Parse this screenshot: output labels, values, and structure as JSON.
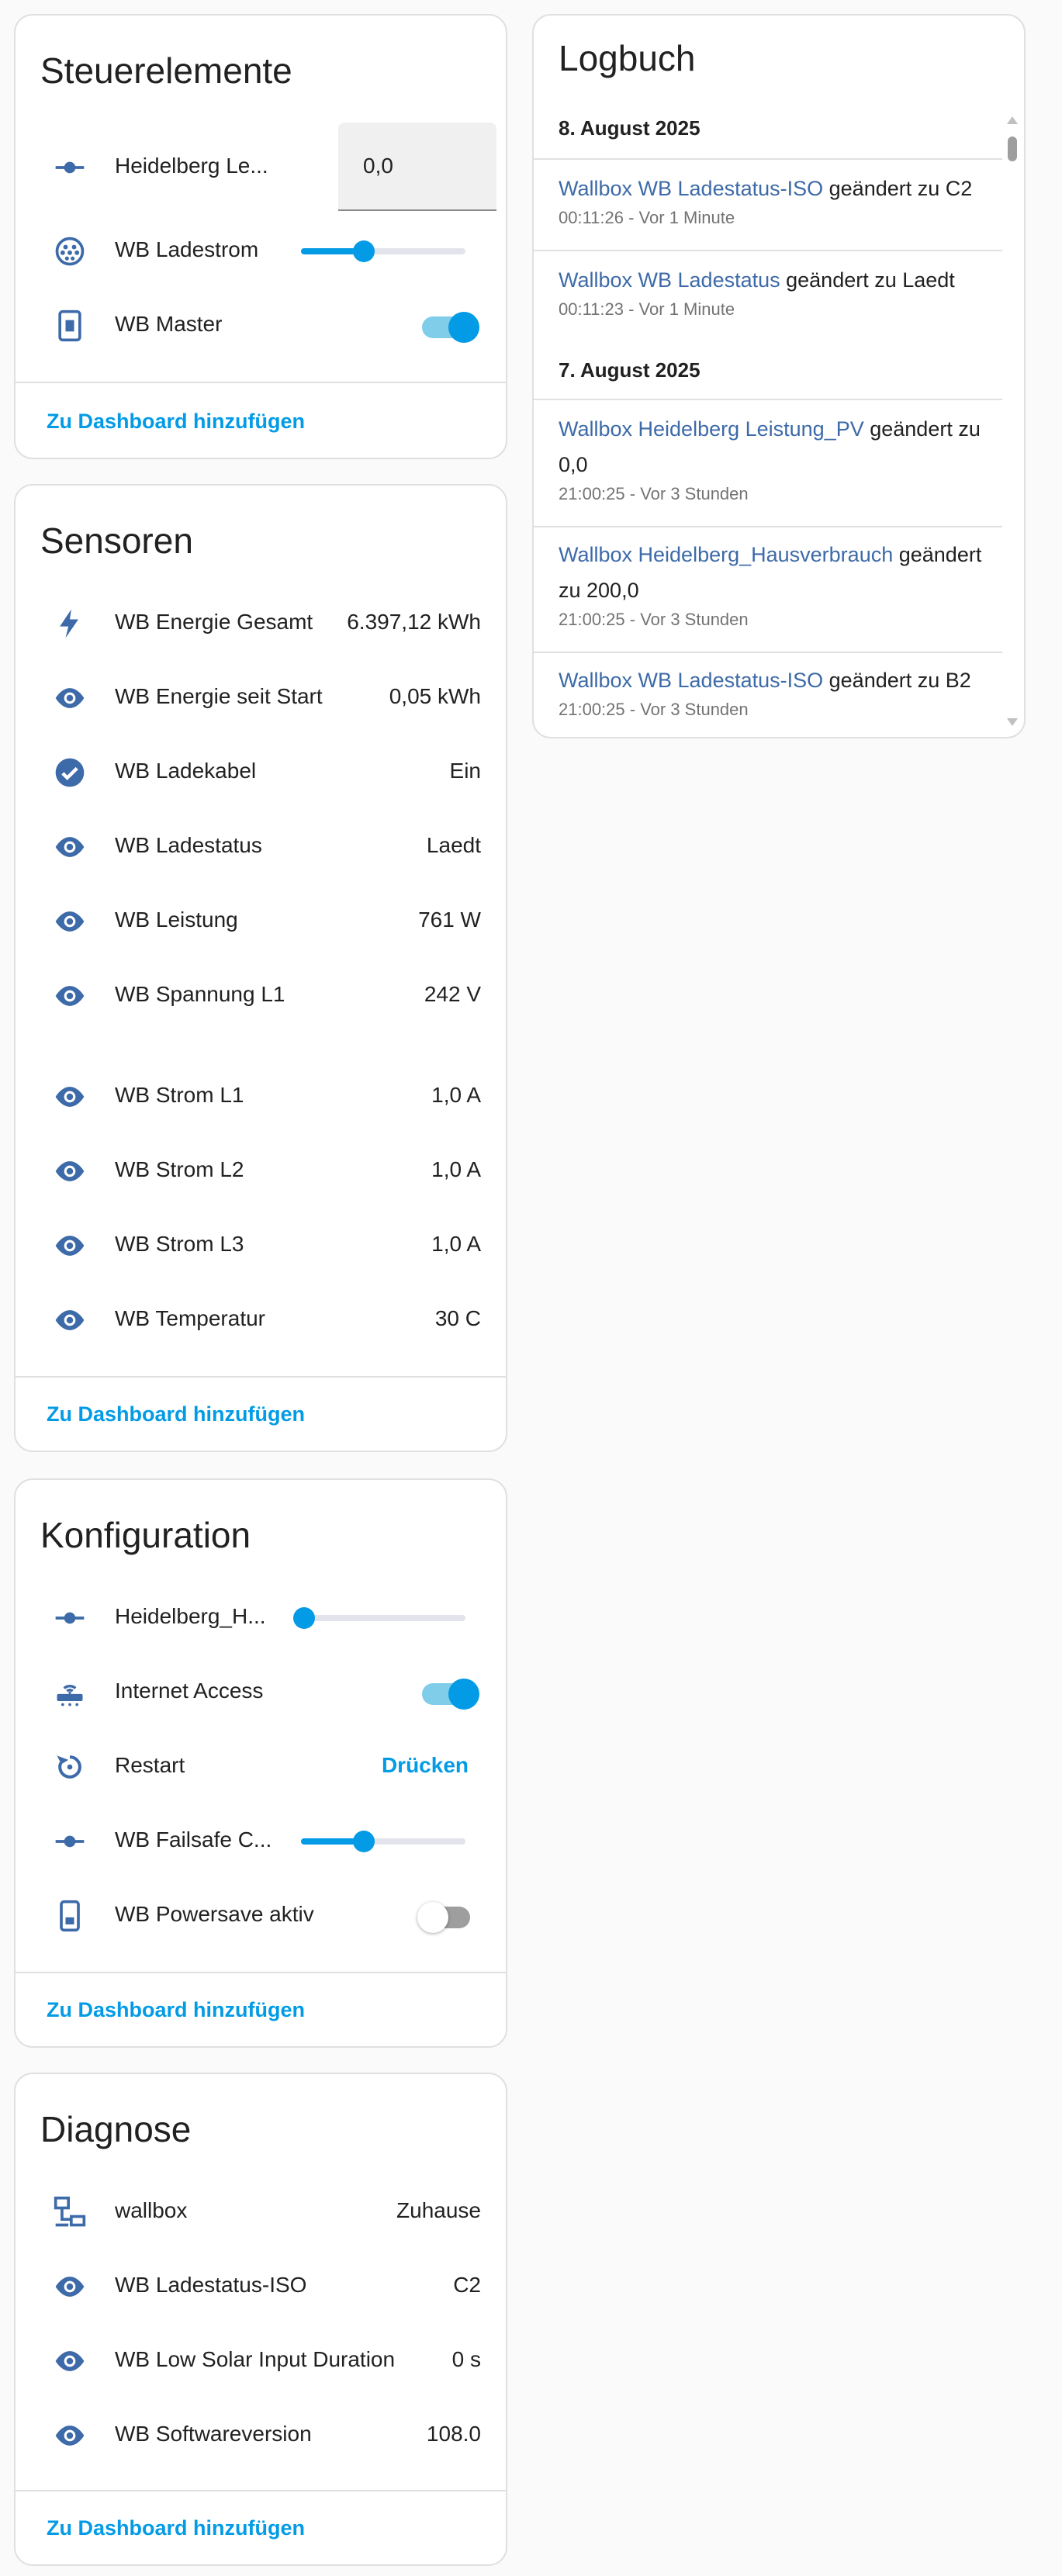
{
  "colors": {
    "accent": "#039be5",
    "icon": "#3d6aa8",
    "link": "#3d6aa8"
  },
  "controls": {
    "title": "Steuerelemente",
    "rows": [
      {
        "icon": "slider-dot-icon",
        "label": "Heidelberg Le...",
        "value": "0,0"
      },
      {
        "icon": "ev-plug-icon",
        "label": "WB Ladestrom",
        "slider_value": 0.38
      },
      {
        "icon": "tablet-icon",
        "label": "WB Master",
        "toggle": true
      }
    ],
    "footer": "Zu Dashboard hinzufügen"
  },
  "sensors": {
    "title": "Sensoren",
    "rows": [
      {
        "icon": "flash-icon",
        "label": "WB Energie Gesamt",
        "value": "6.397,12 kWh"
      },
      {
        "icon": "eye-icon",
        "label": "WB Energie seit Start",
        "value": "0,05 kWh"
      },
      {
        "icon": "check-circle-icon",
        "label": "WB Ladekabel",
        "value": "Ein"
      },
      {
        "icon": "eye-icon",
        "label": "WB Ladestatus",
        "value": "Laedt"
      },
      {
        "icon": "eye-icon",
        "label": "WB Leistung",
        "value": "761 W"
      },
      {
        "icon": "eye-icon",
        "label": "WB Spannung L1",
        "value": "242 V"
      },
      {
        "icon": "eye-icon",
        "label": "WB Strom L1",
        "value": "1,0 A"
      },
      {
        "icon": "eye-icon",
        "label": "WB Strom L2",
        "value": "1,0 A"
      },
      {
        "icon": "eye-icon",
        "label": "WB Strom L3",
        "value": "1,0 A"
      },
      {
        "icon": "eye-icon",
        "label": "WB Temperatur",
        "value": "30 C"
      }
    ],
    "footer": "Zu Dashboard hinzufügen"
  },
  "config": {
    "title": "Konfiguration",
    "rows": [
      {
        "icon": "slider-dot-icon",
        "label": "Heidelberg_H...",
        "slider_value": 0.02
      },
      {
        "icon": "router-icon",
        "label": "Internet Access",
        "toggle": true
      },
      {
        "icon": "restart-icon",
        "label": "Restart",
        "button": "Drücken"
      },
      {
        "icon": "slider-dot-icon",
        "label": "WB Failsafe C...",
        "slider_value": 0.38
      },
      {
        "icon": "phone-battery-icon",
        "label": "WB Powersave aktiv",
        "toggle": false
      }
    ],
    "footer": "Zu Dashboard hinzufügen"
  },
  "diag": {
    "title": "Diagnose",
    "rows": [
      {
        "icon": "network-icon",
        "label": "wallbox",
        "value": "Zuhause"
      },
      {
        "icon": "eye-icon",
        "label": "WB Ladestatus-ISO",
        "value": "C2"
      },
      {
        "icon": "eye-icon",
        "label": "WB Low Solar Input Duration",
        "value": "0 s"
      },
      {
        "icon": "eye-icon",
        "label": "WB Softwareversion",
        "value": "108.0"
      }
    ],
    "footer": "Zu Dashboard hinzufügen"
  },
  "logbook": {
    "title": "Logbuch",
    "day1": "8. August 2025",
    "day2": "7. August 2025",
    "entries": [
      {
        "entity": "Wallbox WB Ladestatus-ISO",
        "text": " geändert zu C2",
        "time": "00:11:26 - Vor 1 Minute"
      },
      {
        "entity": "Wallbox WB Ladestatus",
        "text": " geändert zu Laedt",
        "time": "00:11:23 - Vor 1 Minute"
      },
      {
        "entity": "Wallbox Heidelberg Leistung_PV",
        "text": " geändert zu 0,0",
        "time": "21:00:25 - Vor 3 Stunden"
      },
      {
        "entity": "Wallbox Heidelberg_Hausverbrauch",
        "text": " geändert zu 200,0",
        "time": "21:00:25 - Vor 3 Stunden"
      },
      {
        "entity": "Wallbox WB Ladestatus-ISO",
        "text": " geändert zu B2",
        "time": "21:00:25 - Vor 3 Stunden"
      }
    ]
  }
}
